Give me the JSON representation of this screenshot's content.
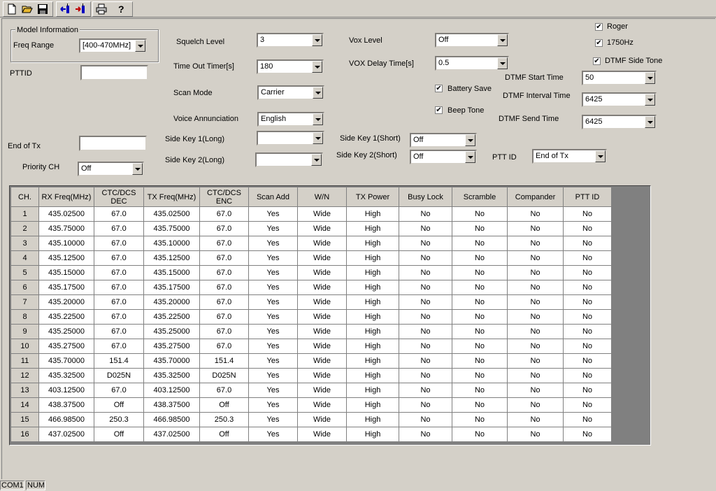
{
  "toolbar": {
    "icons": [
      "new-file-icon",
      "open-folder-icon",
      "save-icon",
      "read-from-radio-icon",
      "write-to-radio-icon",
      "print-icon",
      "help-icon"
    ]
  },
  "model_info": {
    "group_label": "Model Information",
    "freq_range_label": "Freq Range",
    "freq_range_value": "[400-470MHz]"
  },
  "pttid": {
    "label": "PTTID",
    "value": ""
  },
  "end_of_tx": {
    "label": "End of Tx",
    "value": ""
  },
  "priority_ch": {
    "label": "Priority CH",
    "value": "Off"
  },
  "settings": {
    "squelch_label": "Squelch Level",
    "squelch_value": "3",
    "timeout_label": "Time Out Timer[s]",
    "timeout_value": "180",
    "scan_mode_label": "Scan Mode",
    "scan_mode_value": "Carrier",
    "voice_label": "Voice Annunciation",
    "voice_value": "English",
    "side_key1_long_label": "Side Key 1(Long)",
    "side_key1_long_value": "",
    "side_key2_long_label": "Side Key 2(Long)",
    "side_key2_long_value": "",
    "vox_level_label": "Vox Level",
    "vox_level_value": "Off",
    "vox_delay_label": "VOX Delay Time[s]",
    "vox_delay_value": "0.5",
    "battery_save_label": "Battery Save",
    "beep_tone_label": "Beep Tone",
    "side_key1_short_label": "Side Key 1(Short)",
    "side_key1_short_value": "Off",
    "side_key2_short_label": "Side Key 2(Short)",
    "side_key2_short_value": "Off",
    "ptt_id_label": "PTT ID",
    "ptt_id_value": "End of Tx",
    "roger_label": "Roger",
    "hz1750_label": "1750Hz",
    "dtmf_side_tone_label": "DTMF Side Tone",
    "dtmf_start_label": "DTMF Start Time",
    "dtmf_start_value": "50",
    "dtmf_interval_label": "DTMF Interval Time",
    "dtmf_interval_value": "6425",
    "dtmf_send_label": "DTMF Send Time",
    "dtmf_send_value": "6425",
    "check_mark": "✔"
  },
  "table": {
    "headers": [
      "CH.",
      "RX Freq(MHz)",
      "CTC/DCS\nDEC",
      "TX Freq(MHz)",
      "CTC/DCS\nENC",
      "Scan Add",
      "W/N",
      "TX Power",
      "Busy Lock",
      "Scramble",
      "Compander",
      "PTT ID"
    ],
    "rows": [
      [
        "1",
        "435.02500",
        "67.0",
        "435.02500",
        "67.0",
        "Yes",
        "Wide",
        "High",
        "No",
        "No",
        "No",
        "No"
      ],
      [
        "2",
        "435.75000",
        "67.0",
        "435.75000",
        "67.0",
        "Yes",
        "Wide",
        "High",
        "No",
        "No",
        "No",
        "No"
      ],
      [
        "3",
        "435.10000",
        "67.0",
        "435.10000",
        "67.0",
        "Yes",
        "Wide",
        "High",
        "No",
        "No",
        "No",
        "No"
      ],
      [
        "4",
        "435.12500",
        "67.0",
        "435.12500",
        "67.0",
        "Yes",
        "Wide",
        "High",
        "No",
        "No",
        "No",
        "No"
      ],
      [
        "5",
        "435.15000",
        "67.0",
        "435.15000",
        "67.0",
        "Yes",
        "Wide",
        "High",
        "No",
        "No",
        "No",
        "No"
      ],
      [
        "6",
        "435.17500",
        "67.0",
        "435.17500",
        "67.0",
        "Yes",
        "Wide",
        "High",
        "No",
        "No",
        "No",
        "No"
      ],
      [
        "7",
        "435.20000",
        "67.0",
        "435.20000",
        "67.0",
        "Yes",
        "Wide",
        "High",
        "No",
        "No",
        "No",
        "No"
      ],
      [
        "8",
        "435.22500",
        "67.0",
        "435.22500",
        "67.0",
        "Yes",
        "Wide",
        "High",
        "No",
        "No",
        "No",
        "No"
      ],
      [
        "9",
        "435.25000",
        "67.0",
        "435.25000",
        "67.0",
        "Yes",
        "Wide",
        "High",
        "No",
        "No",
        "No",
        "No"
      ],
      [
        "10",
        "435.27500",
        "67.0",
        "435.27500",
        "67.0",
        "Yes",
        "Wide",
        "High",
        "No",
        "No",
        "No",
        "No"
      ],
      [
        "11",
        "435.70000",
        "151.4",
        "435.70000",
        "151.4",
        "Yes",
        "Wide",
        "High",
        "No",
        "No",
        "No",
        "No"
      ],
      [
        "12",
        "435.32500",
        "D025N",
        "435.32500",
        "D025N",
        "Yes",
        "Wide",
        "High",
        "No",
        "No",
        "No",
        "No"
      ],
      [
        "13",
        "403.12500",
        "67.0",
        "403.12500",
        "67.0",
        "Yes",
        "Wide",
        "High",
        "No",
        "No",
        "No",
        "No"
      ],
      [
        "14",
        "438.37500",
        "Off",
        "438.37500",
        "Off",
        "Yes",
        "Wide",
        "High",
        "No",
        "No",
        "No",
        "No"
      ],
      [
        "15",
        "466.98500",
        "250.3",
        "466.98500",
        "250.3",
        "Yes",
        "Wide",
        "High",
        "No",
        "No",
        "No",
        "No"
      ],
      [
        "16",
        "437.02500",
        "Off",
        "437.02500",
        "Off",
        "Yes",
        "Wide",
        "High",
        "No",
        "No",
        "No",
        "No"
      ]
    ]
  },
  "statusbar": {
    "port": "COM1",
    "num": "NUM"
  }
}
